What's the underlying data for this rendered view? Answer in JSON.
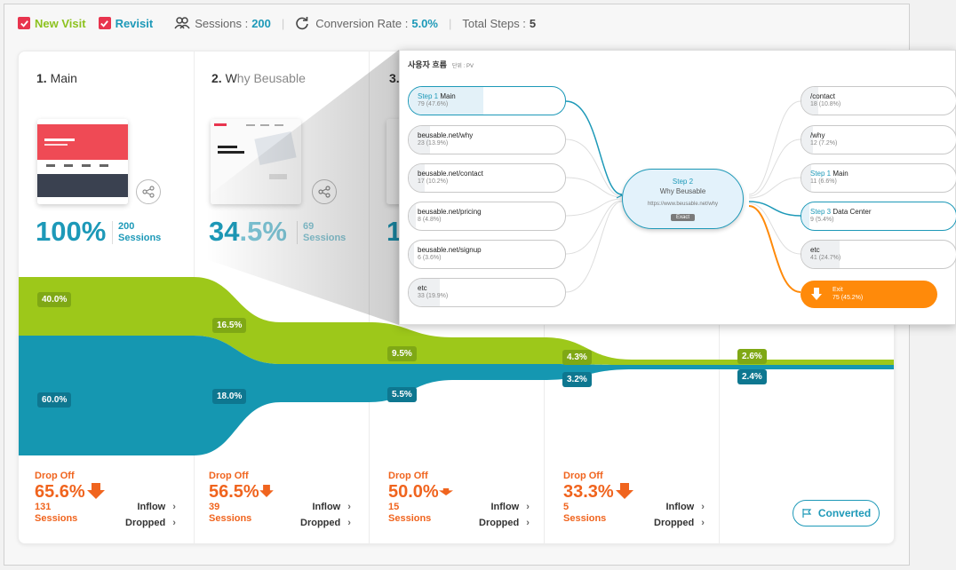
{
  "filters": {
    "new_visit": "New Visit",
    "revisit": "Revisit",
    "sessions_label": "Sessions :",
    "sessions_value": "200",
    "conversion_label": "Conversion Rate :",
    "conversion_value": "5.0%",
    "total_steps_label": "Total Steps :",
    "total_steps_value": "5"
  },
  "steps": [
    {
      "num": "1.",
      "name": "Main",
      "pct": "100%",
      "sessions_num": "200",
      "sessions_label": "Sessions"
    },
    {
      "num": "2.",
      "name_visible": "W",
      "name_rest": "hy Beusable",
      "pct_a": "34",
      "pct_b": ".5%",
      "sessions_num": "69",
      "sessions_label": "Sessions"
    },
    {
      "num": "3.",
      "pct": "1"
    }
  ],
  "flow": {
    "green": [
      "40.0%",
      "16.5%",
      "9.5%",
      "4.3%",
      "2.6%"
    ],
    "blue": [
      "60.0%",
      "18.0%",
      "5.5%",
      "3.2%",
      "2.4%"
    ]
  },
  "dropoffs": [
    {
      "title": "Drop Off",
      "pct": "65.6%",
      "count": "131",
      "label": "Sessions"
    },
    {
      "title": "Drop Off",
      "pct": "56.5%",
      "count": "39",
      "label": "Sessions"
    },
    {
      "title": "Drop Off",
      "pct": "50.0%",
      "count": "15",
      "label": "Sessions"
    },
    {
      "title": "Drop Off",
      "pct": "33.3%",
      "count": "5",
      "label": "Sessions"
    }
  ],
  "inflow": "Inflow",
  "dropped": "Dropped",
  "converted": "Converted",
  "popup": {
    "title": "사용자 흐름",
    "unit": "단위 : PV",
    "left": [
      {
        "url_a": "Step 1",
        "url_b": " Main",
        "count": "79 (47.6%)",
        "fill": 0.476
      },
      {
        "url": "beusable.net/why",
        "count": "23 (13.9%)",
        "fill": 0.139
      },
      {
        "url": "beusable.net/contact",
        "count": "17 (10.2%)",
        "fill": 0.102
      },
      {
        "url": "beusable.net/pricing",
        "count": "8 (4.8%)",
        "fill": 0.048
      },
      {
        "url": "beusable.net/signup",
        "count": "6 (3.6%)",
        "fill": 0.036
      },
      {
        "url": "etc",
        "count": "33 (19.9%)",
        "fill": 0.199
      }
    ],
    "center": {
      "step": "Step 2",
      "name": "Why Beusable",
      "url": "https://www.beusable.net/why",
      "badge": "Exact"
    },
    "right": [
      {
        "url": "/contact",
        "count": "18 (10.8%)",
        "fill": 0.108
      },
      {
        "url": "/why",
        "count": "12 (7.2%)",
        "fill": 0.072
      },
      {
        "url_a": "Step 1",
        "url_b": " Main",
        "count": "11 (6.6%)",
        "fill": 0.066
      },
      {
        "url_a": "Step 3",
        "url_b": " Data Center",
        "count": "9 (5.4%)",
        "fill": 0.054
      },
      {
        "url": "etc",
        "count": "41 (24.7%)",
        "fill": 0.247
      }
    ],
    "exit": {
      "label": "Exit",
      "count": "75 (45.2%)"
    }
  },
  "colors": {
    "green": "#9dc81a",
    "blue": "#1597b1",
    "orange": "#f0641e",
    "accent": "#1d99b8",
    "checkbox": "#e8344e",
    "exit": "#ff8a0a"
  }
}
